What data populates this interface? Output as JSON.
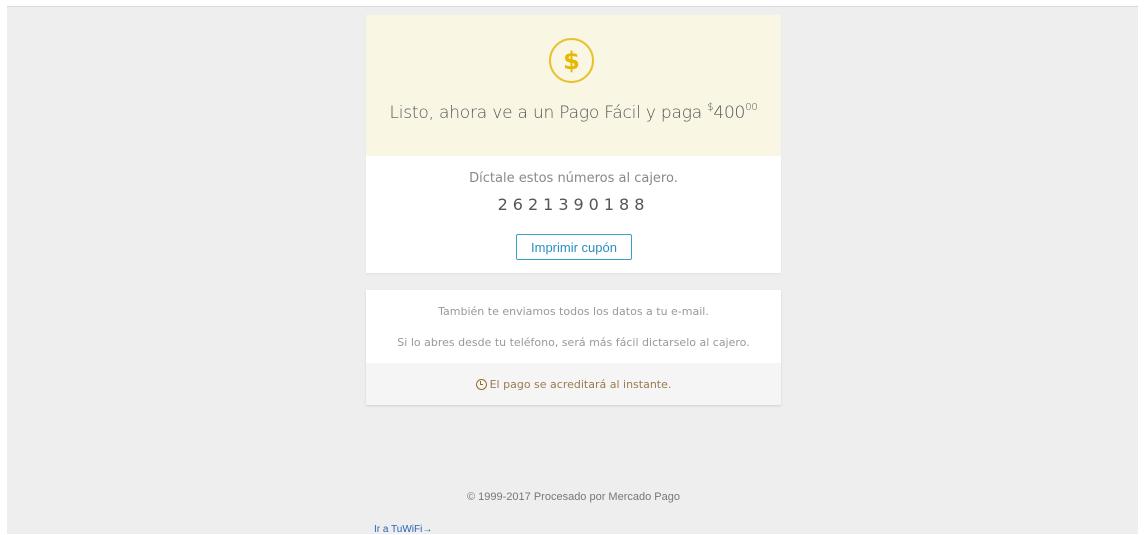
{
  "header": {
    "icon": "dollar-coin-icon",
    "title_prefix": "Listo, ahora ve a un Pago Fácil y paga ",
    "currency": "$",
    "amount_int": "400",
    "amount_dec": "00"
  },
  "payment": {
    "instruction": "Díctale estos números al cajero.",
    "code": "2621390188",
    "print_button": "Imprimir cupón"
  },
  "info": {
    "line1": "También te enviamos todos los datos a tu e-mail.",
    "line2": "Si lo abres desde tu teléfono, será más fácil dictarselo al cajero.",
    "notice_icon": "clock-icon",
    "notice": "El pago se acreditará al instante."
  },
  "footer": {
    "copyright": "© 1999-2017 Procesado por Mercado Pago",
    "back_link": "Ir a TuWiFi→"
  },
  "colors": {
    "header_bg": "#f9f7e4",
    "coin": "#e7c22f",
    "button_border": "#3aa0c8",
    "link": "#2a62b8"
  }
}
